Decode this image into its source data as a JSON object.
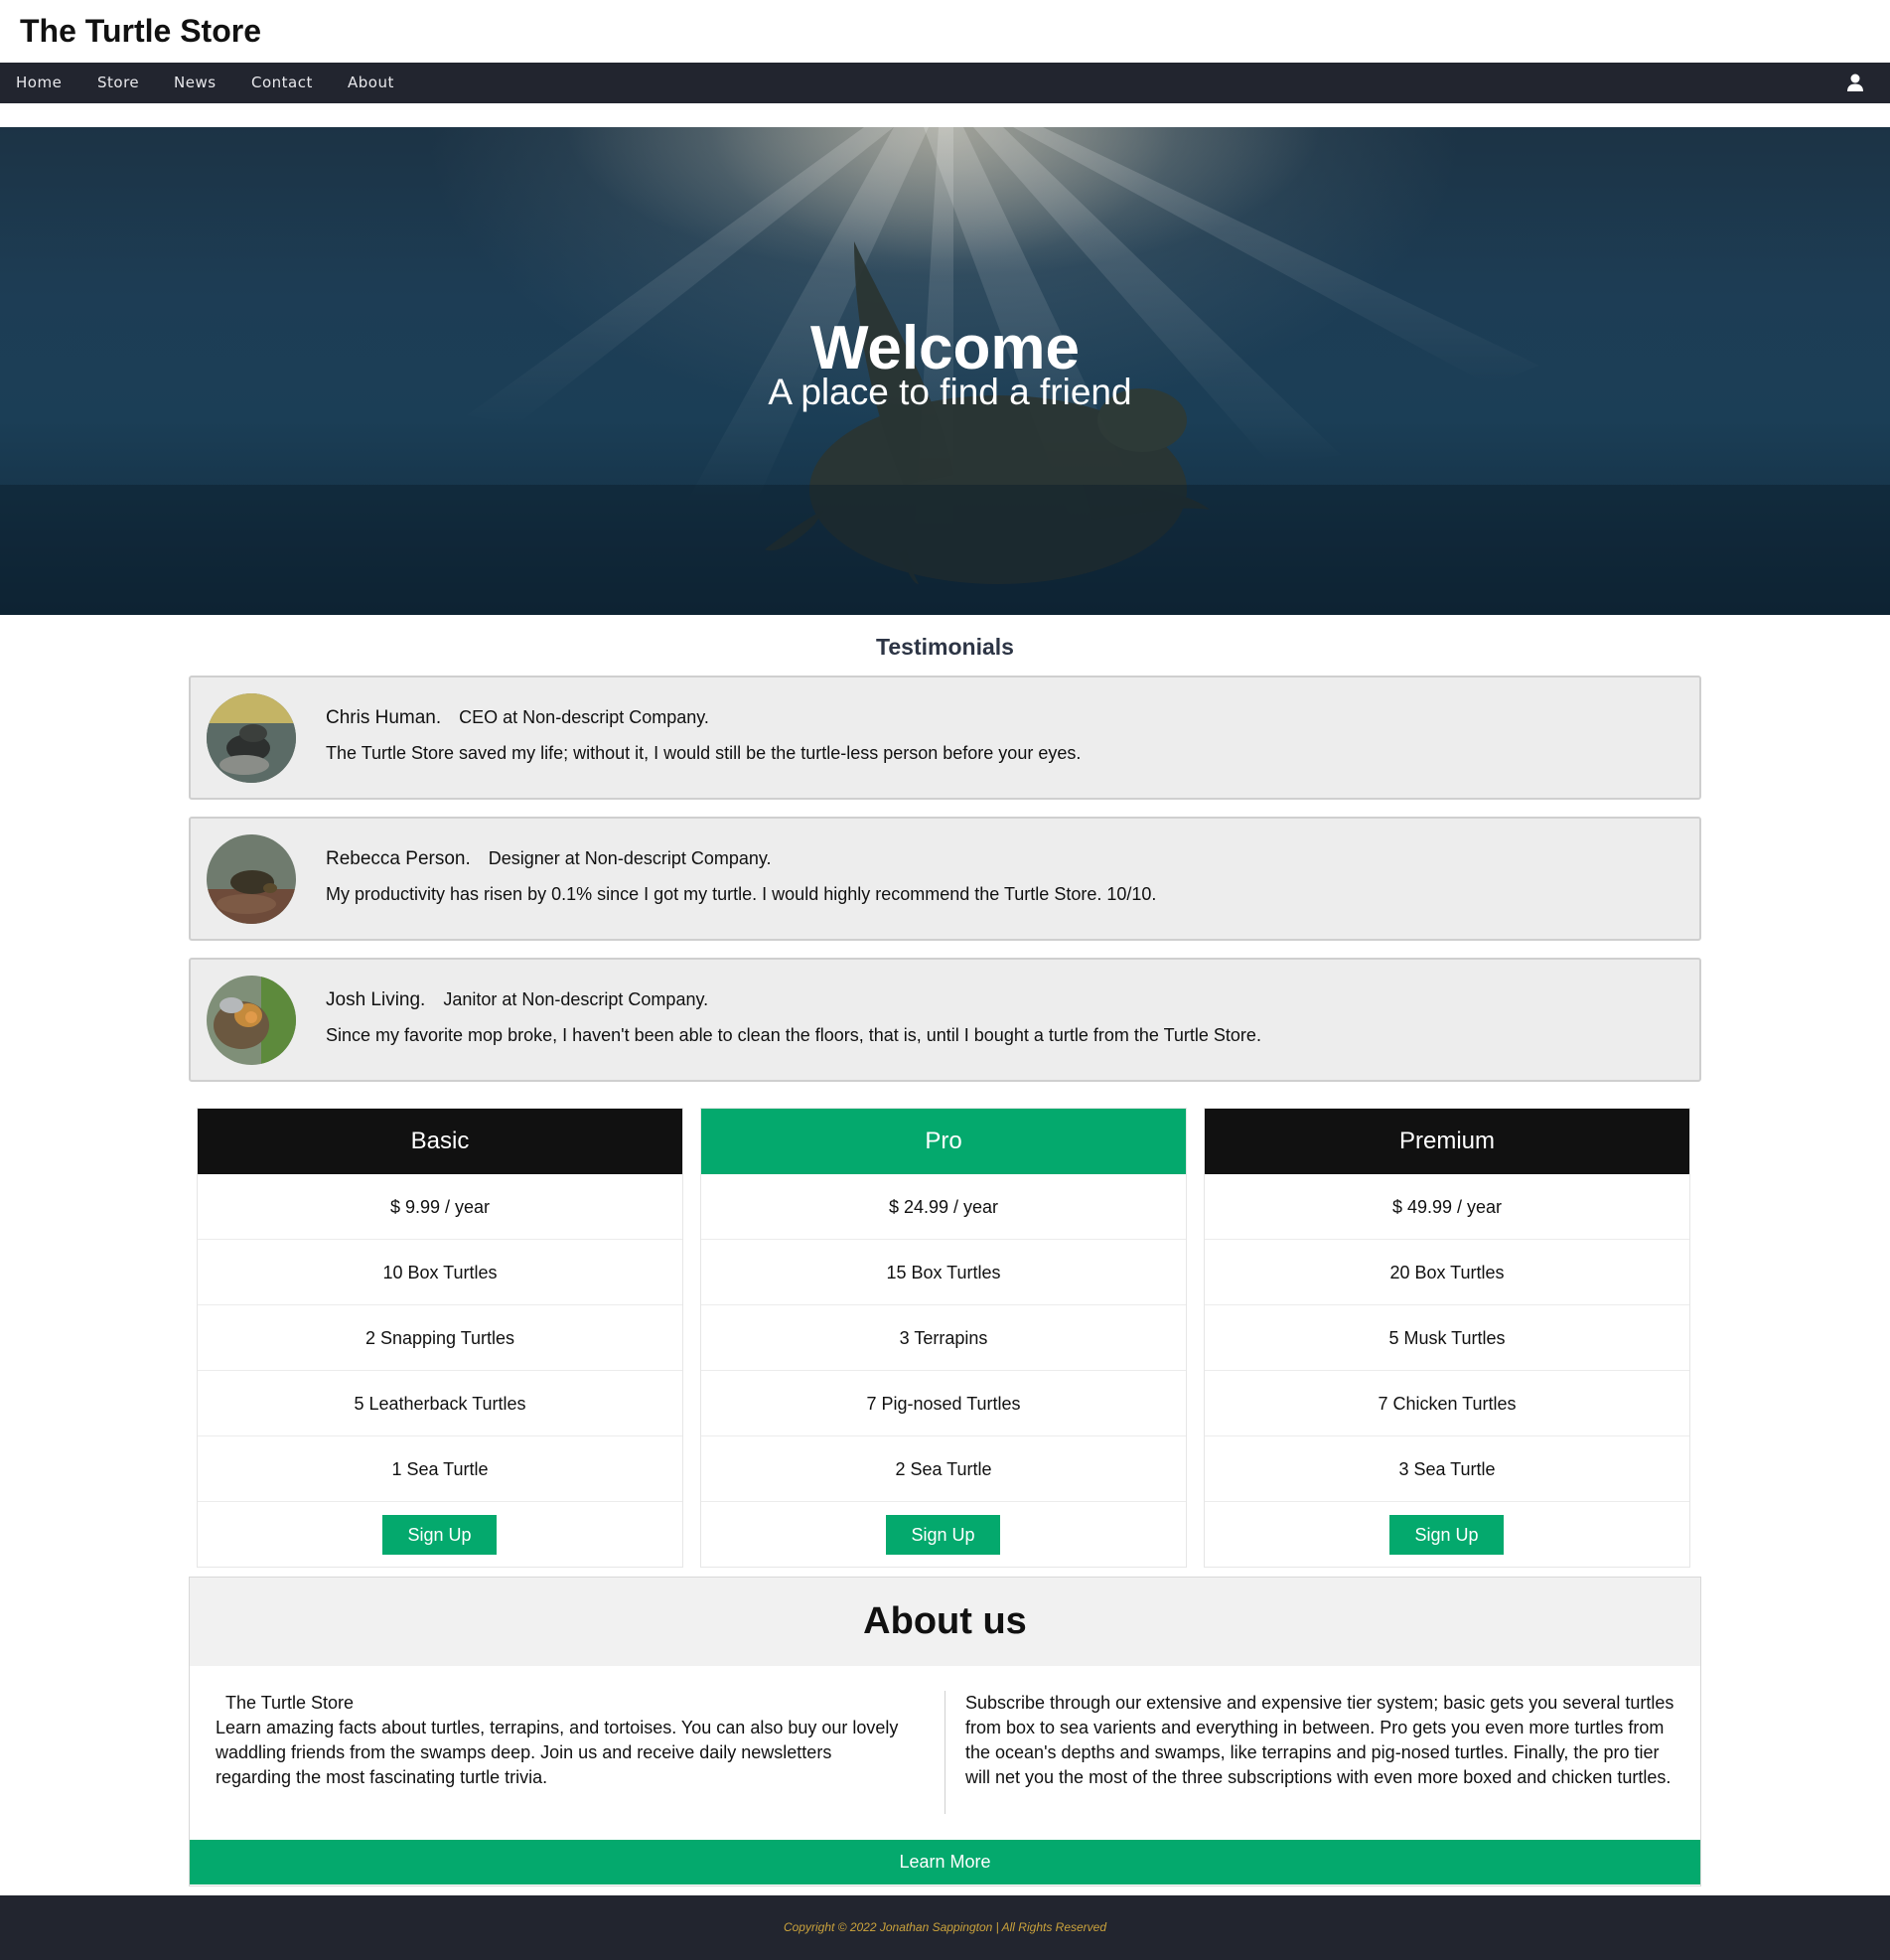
{
  "header": {
    "title": "The Turtle Store"
  },
  "nav": {
    "items": [
      "Home",
      "Store",
      "News",
      "Contact",
      "About"
    ],
    "user_icon": "user-icon"
  },
  "hero": {
    "title": "Welcome",
    "subtitle": "A place to find a friend"
  },
  "testimonials": {
    "heading": "Testimonials",
    "items": [
      {
        "name": "Chris Human.",
        "role": "CEO at Non-descript Company.",
        "quote": "The Turtle Store saved my life; without it, I would still be the turtle-less person before your eyes."
      },
      {
        "name": "Rebecca Person.",
        "role": "Designer at Non-descript Company.",
        "quote": "My productivity has risen by 0.1% since I got my turtle. I would highly recommend the Turtle Store. 10/10."
      },
      {
        "name": "Josh Living.",
        "role": "Janitor at Non-descript Company.",
        "quote": "Since my favorite mop broke, I haven't been able to clean the floors, that is, until I bought a turtle from the Turtle Store."
      }
    ]
  },
  "pricing": {
    "plans": [
      {
        "name": "Basic",
        "price": "$ 9.99 / year",
        "features": [
          "10 Box Turtles",
          "2 Snapping Turtles",
          "5 Leatherback Turtles",
          "1 Sea Turtle"
        ],
        "button": "Sign Up"
      },
      {
        "name": "Pro",
        "price": "$ 24.99 / year",
        "features": [
          "15 Box Turtles",
          "3 Terrapins",
          "7 Pig-nosed Turtles",
          "2 Sea Turtle"
        ],
        "button": "Sign Up"
      },
      {
        "name": "Premium",
        "price": "$ 49.99 / year",
        "features": [
          "20 Box Turtles",
          "5 Musk Turtles",
          "7 Chicken Turtles",
          "3 Sea Turtle"
        ],
        "button": "Sign Up"
      }
    ]
  },
  "about": {
    "heading": "About us",
    "brand": "The Turtle Store",
    "left_text": "Learn amazing facts about turtles, terrapins, and tortoises. You can also buy our lovely waddling friends from the swamps deep. Join us and receive daily newsletters regarding the most fascinating turtle trivia.",
    "right_text": "Subscribe through our extensive and expensive tier system; basic gets you several turtles from box to sea varients and everything in between. Pro gets you even more turtles from the ocean's depths and swamps, like terrapins and pig-nosed turtles. Finally, the pro tier will net you the most of the three subscriptions with even more boxed and chicken turtles.",
    "button": "Learn More"
  },
  "footer": {
    "copyright": "Copyright © 2022 Jonathan Sappington | All Rights Reserved"
  },
  "colors": {
    "accent": "#04a96d",
    "nav_bg": "#22252f",
    "copyright": "#caa23c"
  }
}
